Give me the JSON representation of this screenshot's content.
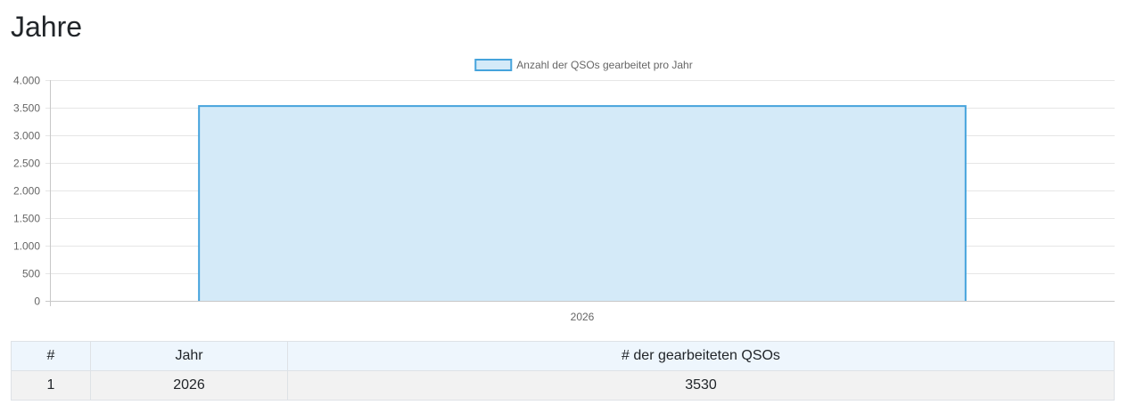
{
  "page": {
    "title": "Jahre"
  },
  "chart_data": {
    "type": "bar",
    "categories": [
      "2026"
    ],
    "series": [
      {
        "name": "Anzahl der QSOs gearbeitet pro Jahr",
        "values": [
          3530
        ]
      }
    ],
    "ylim": [
      0,
      4000
    ],
    "yticks": [
      "0",
      "500",
      "1.000",
      "1.500",
      "2.000",
      "2.500",
      "3.000",
      "3.500",
      "4.000"
    ],
    "ytick_values": [
      0,
      500,
      1000,
      1500,
      2000,
      2500,
      3000,
      3500,
      4000
    ],
    "grid": true,
    "legend": "top-center",
    "colors": {
      "fill": "#d4eaf8",
      "border": "#45a3dc",
      "grid": "#e6e6e6",
      "axis": "#c8c8c8"
    }
  },
  "table": {
    "headers": [
      "#",
      "Jahr",
      "# der gearbeiteten QSOs"
    ],
    "rows": [
      [
        "1",
        "2026",
        "3530"
      ]
    ]
  }
}
